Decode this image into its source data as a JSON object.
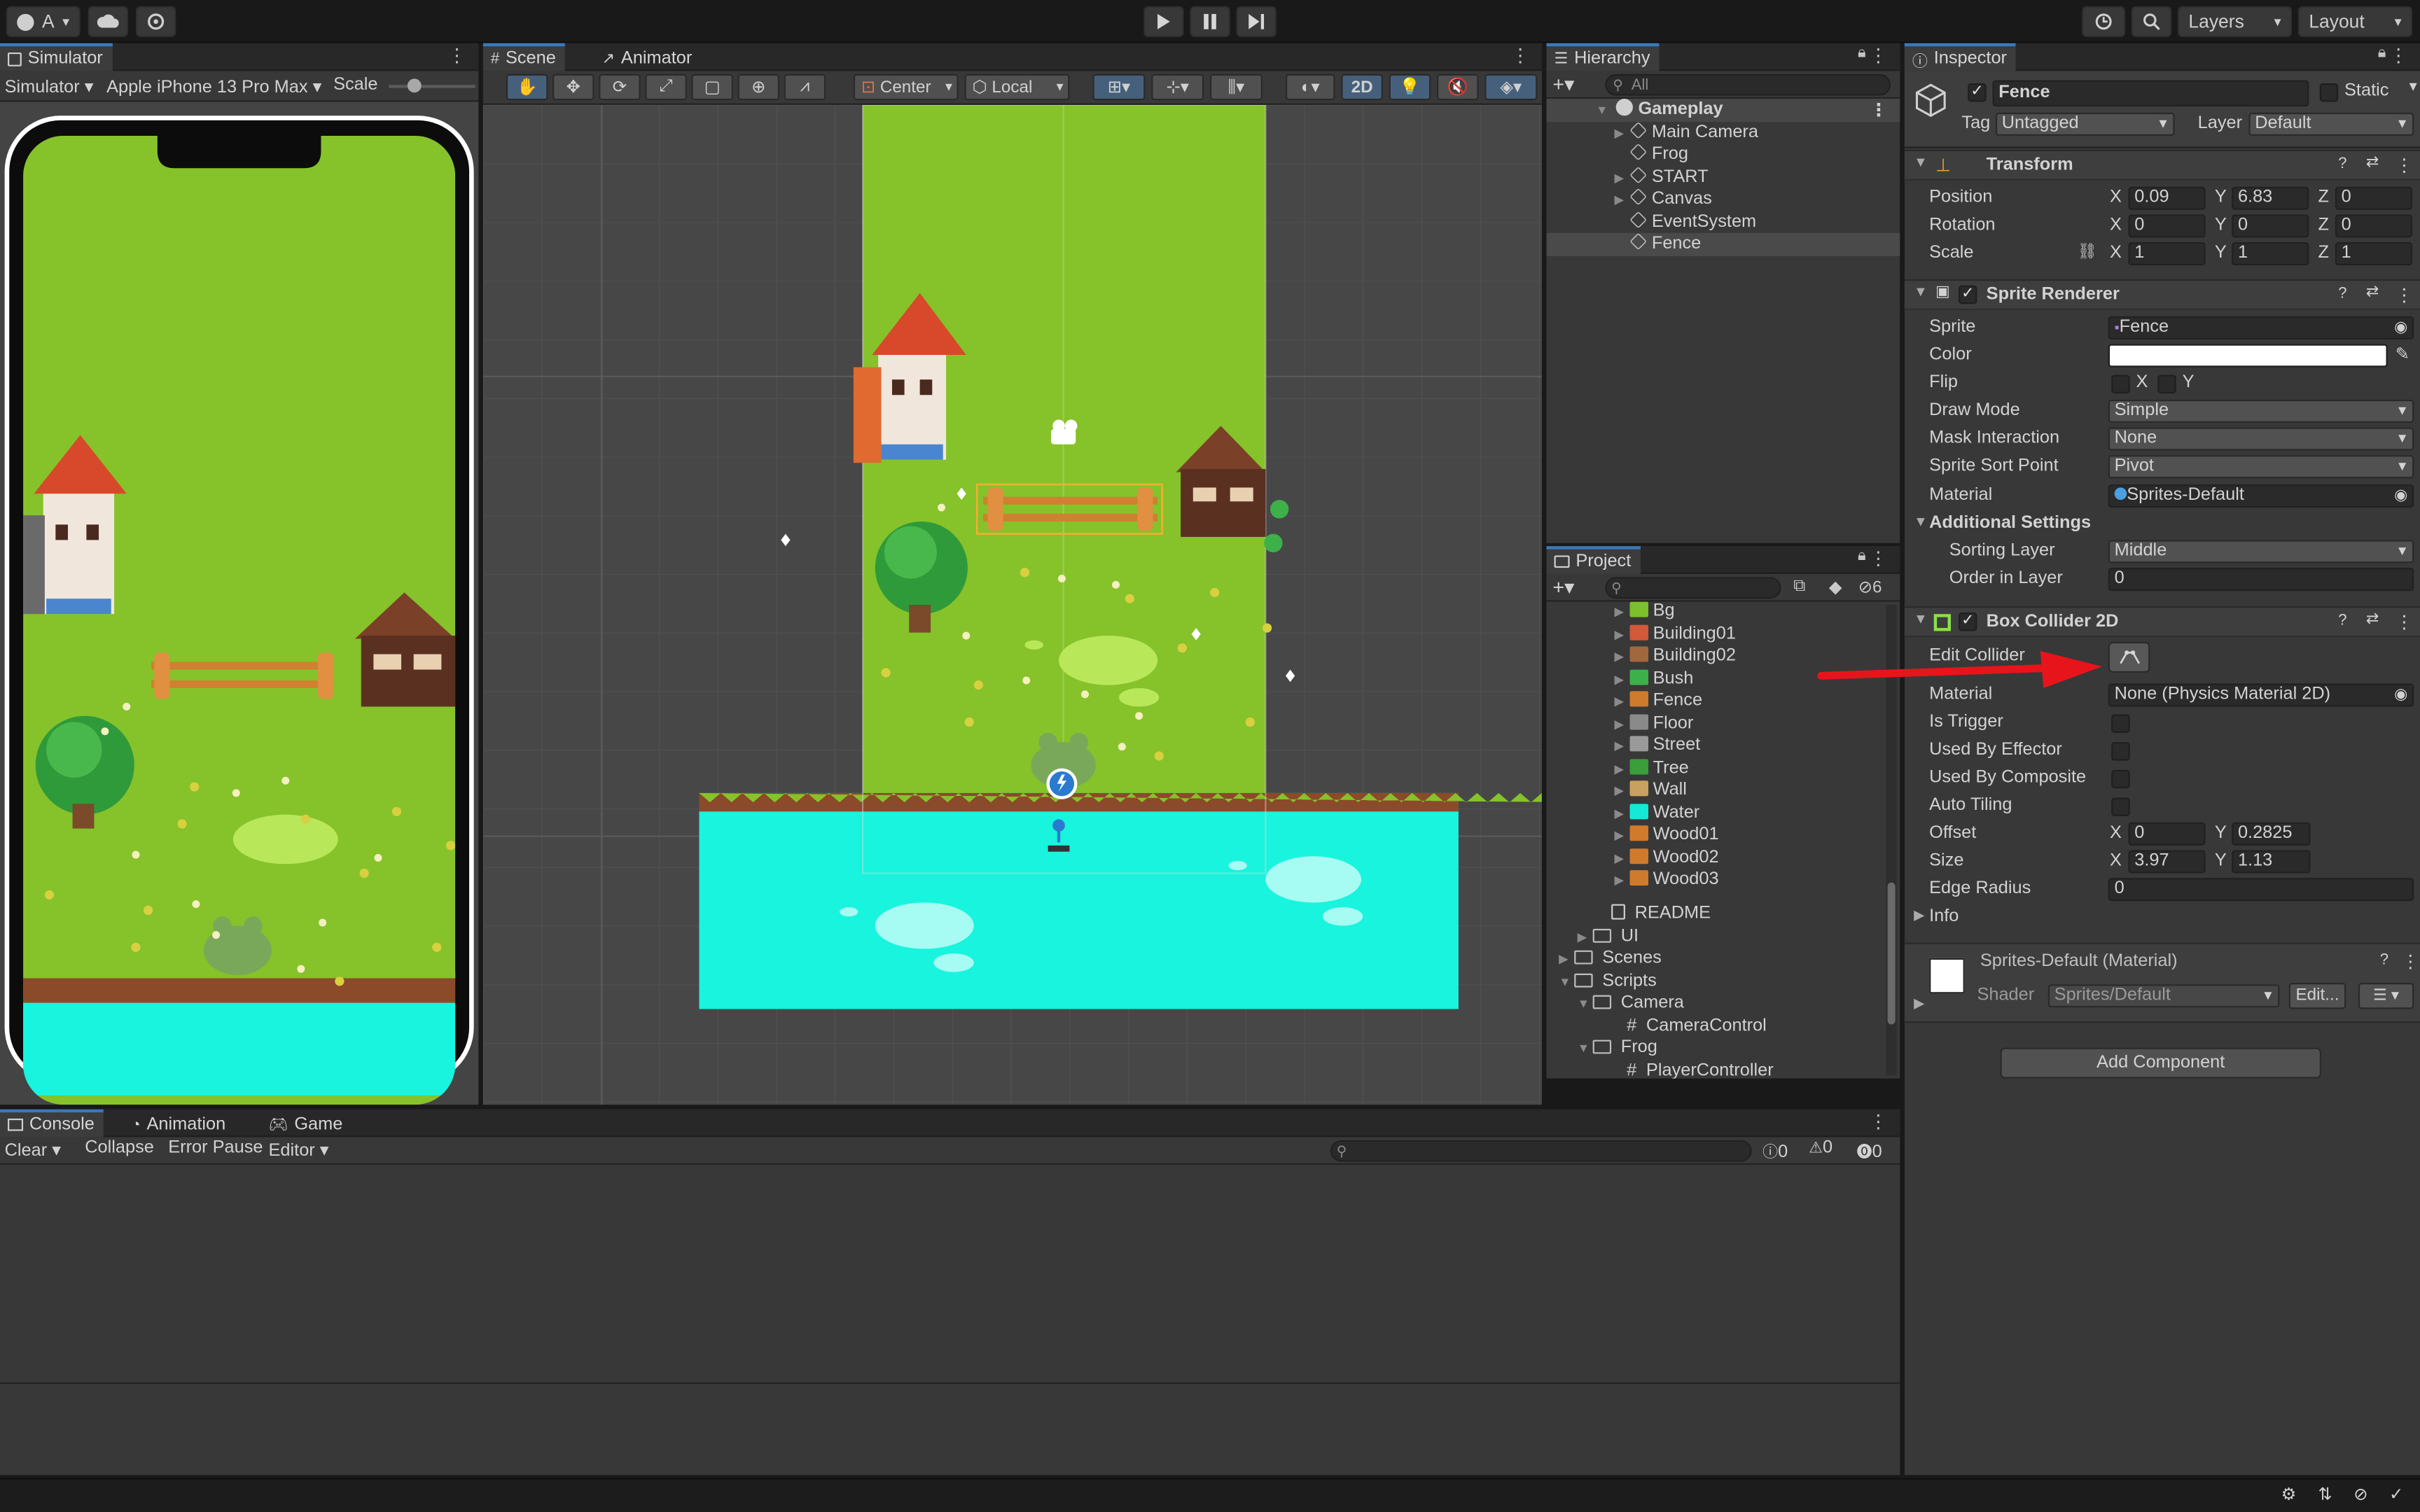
{
  "toolbar": {
    "account_label": "A",
    "layers_label": "Layers",
    "layout_label": "Layout"
  },
  "simulator": {
    "tab_label": "Simulator",
    "mode_label": "Simulator",
    "device_label": "Apple iPhone 13 Pro Max",
    "scale_label": "Scale"
  },
  "scene": {
    "tab_label": "Scene",
    "animator_tab_label": "Animator",
    "pivot_label": "Center",
    "space_label": "Local",
    "mode_2d_label": "2D"
  },
  "hierarchy": {
    "tab_label": "Hierarchy",
    "search_placeholder": "All",
    "root": "Gameplay",
    "items": [
      "Main Camera",
      "Frog",
      "START",
      "Canvas",
      "EventSystem",
      "Fence"
    ]
  },
  "project": {
    "tab_label": "Project",
    "hidden_count": "6",
    "sprites": [
      {
        "name": "Bg",
        "color": "#7cc02c"
      },
      {
        "name": "Building01",
        "color": "#d4583a"
      },
      {
        "name": "Building02",
        "color": "#a0683c"
      },
      {
        "name": "Bush",
        "color": "#3db04a"
      },
      {
        "name": "Fence",
        "color": "#d07a2c"
      },
      {
        "name": "Floor",
        "color": "#8a8a8a"
      },
      {
        "name": "Street",
        "color": "#9a9a9a"
      },
      {
        "name": "Tree",
        "color": "#3a9e3a"
      },
      {
        "name": "Wall",
        "color": "#c8a060"
      },
      {
        "name": "Water",
        "color": "#16e8d6"
      },
      {
        "name": "Wood01",
        "color": "#d07a2c"
      },
      {
        "name": "Wood02",
        "color": "#d07a2c"
      },
      {
        "name": "Wood03",
        "color": "#d07a2c"
      }
    ],
    "readme": "README",
    "ui_folder": "UI",
    "scenes_folder": "Scenes",
    "scripts_folder": "Scripts",
    "camera_folder": "Camera",
    "camera_script": "CameraControl",
    "frog_folder": "Frog",
    "frog_script": "PlayerController"
  },
  "inspector": {
    "tab_label": "Inspector",
    "object_name": "Fence",
    "static_label": "Static",
    "tag_label": "Tag",
    "tag_value": "Untagged",
    "layer_label": "Layer",
    "layer_value": "Default",
    "transform": {
      "title": "Transform",
      "position_label": "Position",
      "rotation_label": "Rotation",
      "scale_label": "Scale",
      "position": {
        "x": "0.09",
        "y": "6.83",
        "z": "0"
      },
      "rotation": {
        "x": "0",
        "y": "0",
        "z": "0"
      },
      "scale": {
        "x": "1",
        "y": "1",
        "z": "1"
      }
    },
    "sprite_renderer": {
      "title": "Sprite Renderer",
      "sprite_label": "Sprite",
      "sprite_value": "Fence",
      "color_label": "Color",
      "flip_label": "Flip",
      "draw_mode_label": "Draw Mode",
      "draw_mode_value": "Simple",
      "mask_label": "Mask Interaction",
      "mask_value": "None",
      "sort_point_label": "Sprite Sort Point",
      "sort_point_value": "Pivot",
      "material_label": "Material",
      "material_value": "Sprites-Default",
      "additional_label": "Additional Settings",
      "sorting_layer_label": "Sorting Layer",
      "sorting_layer_value": "Middle",
      "order_label": "Order in Layer",
      "order_value": "0"
    },
    "box_collider": {
      "title": "Box Collider 2D",
      "edit_collider_label": "Edit Collider",
      "material_label": "Material",
      "material_value": "None (Physics Material 2D)",
      "is_trigger_label": "Is Trigger",
      "effector_label": "Used By Effector",
      "composite_label": "Used By Composite",
      "auto_tiling_label": "Auto Tiling",
      "offset_label": "Offset",
      "offset": {
        "x": "0",
        "y": "0.2825"
      },
      "size_label": "Size",
      "size": {
        "x": "3.97",
        "y": "1.13"
      },
      "edge_radius_label": "Edge Radius",
      "edge_radius_value": "0",
      "info_label": "Info"
    },
    "material_section": {
      "title": "Sprites-Default (Material)",
      "shader_label": "Shader",
      "shader_value": "Sprites/Default",
      "edit_label": "Edit..."
    },
    "add_component_label": "Add Component"
  },
  "console": {
    "tab_label": "Console",
    "animation_tab_label": "Animation",
    "game_tab_label": "Game",
    "clear_label": "Clear",
    "collapse_label": "Collapse",
    "error_pause_label": "Error Pause",
    "editor_label": "Editor",
    "log_count": "0",
    "warning_count": "0",
    "error_count": "0"
  },
  "colors": {
    "accent": "#3a79bb",
    "grass": "#86c22a",
    "water": "#18f4de",
    "annotation_arrow": "#e8141b"
  }
}
